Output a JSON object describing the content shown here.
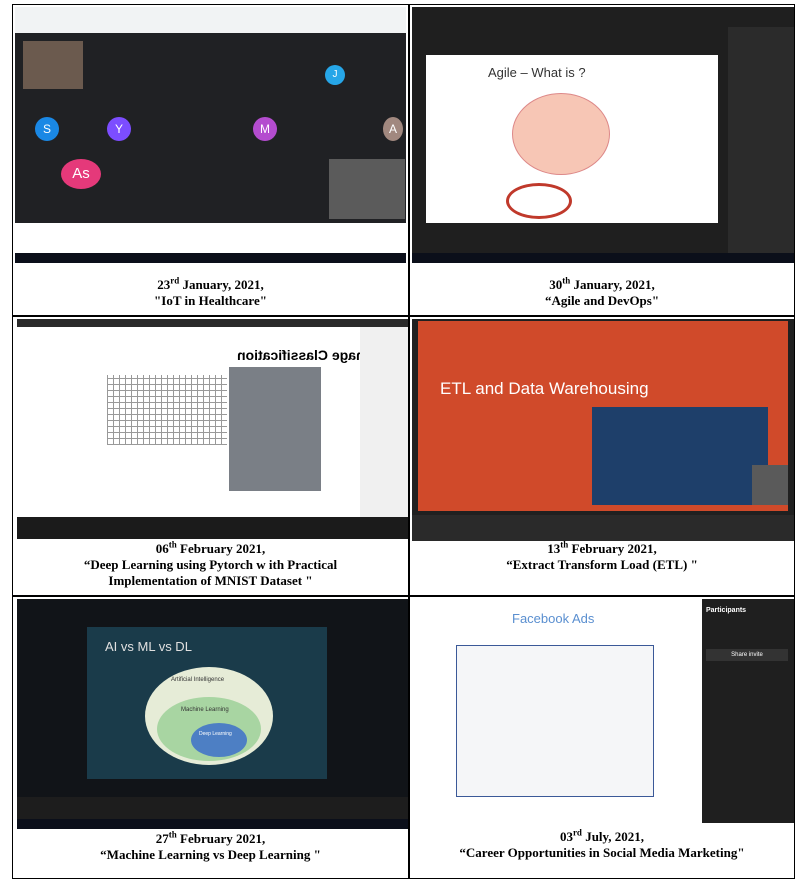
{
  "captions": [
    {
      "day": "23",
      "sup": "rd",
      "rest": " January, 2021,",
      "title": "\"IoT in Healthcare\""
    },
    {
      "day": "30",
      "sup": "th",
      "rest": " January, 2021,",
      "title": "“Agile and DevOps\""
    },
    {
      "day": "06",
      "sup": "th",
      "rest": " February 2021,",
      "title": "“Deep Learning using Pytorch w ith Practical",
      "title2": "Implementation of MNIST Dataset  \""
    },
    {
      "day": "13",
      "sup": "th",
      "rest": " February 2021,",
      "title": "“Extract Transform Load (ETL) \""
    },
    {
      "day": "27",
      "sup": "th",
      "rest": " February 2021,",
      "title": "“Machine Learning vs Deep Learning  \""
    },
    {
      "day": "03",
      "sup": "rd",
      "rest": " July, 2021,",
      "title": "“Career Opportunities in Social Media Marketing\""
    }
  ],
  "slides": {
    "agile_title": "Agile – What is ?",
    "image_classification": "Image Classification",
    "etl_title": "ETL and Data Warehousing",
    "ai_title": "AI vs ML vs DL",
    "ai_outer": "Artificial Intelligence",
    "ai_middle": "Machine Learning",
    "ai_inner": "Deep Learning",
    "fb_title": "Facebook Ads",
    "participants": "Participants",
    "invite": "Share invite"
  },
  "tiles_meet": [
    "S",
    "Y",
    "M",
    "A",
    "J"
  ],
  "tile_as": "As",
  "colors": {
    "meet_bg": "#202124",
    "teams_bg": "#1f1f1f",
    "etl_red": "#d04a2a",
    "ai_bg": "#1a3b4a"
  }
}
